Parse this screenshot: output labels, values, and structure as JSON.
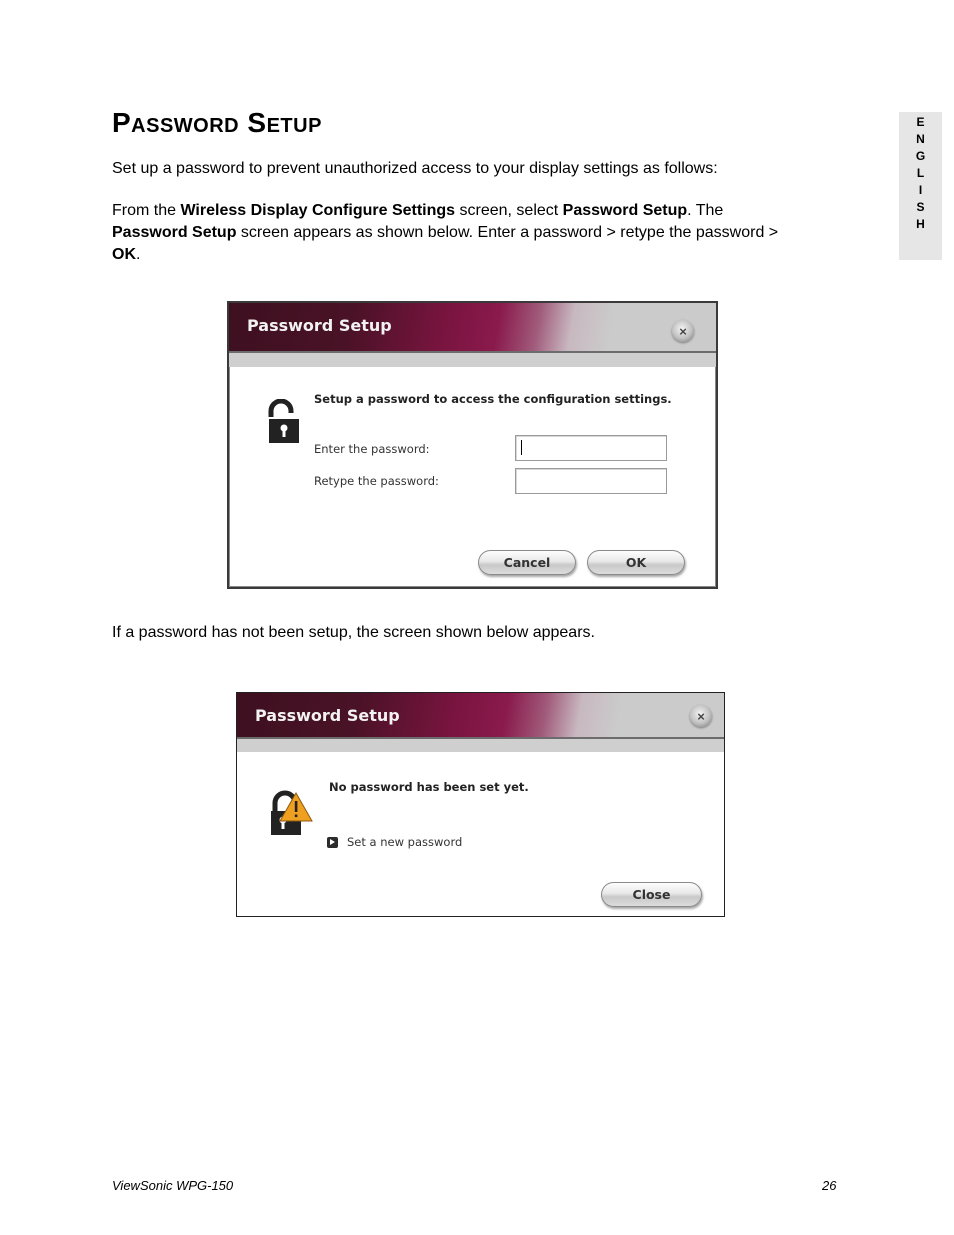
{
  "page": {
    "title": "Password Setup",
    "side_tab": [
      "E",
      "N",
      "G",
      "L",
      "I",
      "S",
      "H"
    ],
    "intro": "Set up a password to prevent unauthorized access to your display settings as follows:",
    "instructions": {
      "p1": "From the ",
      "b1": "Wireless Display Configure Settings",
      "p2": " screen, select ",
      "b2": "Password Setup",
      "p3": ". The ",
      "b3": "Password Setup",
      "p4": " screen appears as shown below. Enter a password > retype the password > ",
      "b4": "OK",
      "p5": "."
    },
    "note": "If a password has not been setup, the screen shown below appears."
  },
  "dialog_setup": {
    "title": "Password Setup",
    "close_icon": "close-x-circle",
    "lock_icon": "unlocked-padlock",
    "heading": "Setup a password to access the configuration settings.",
    "enter_label": "Enter the password:",
    "enter_value": "",
    "retype_label": "Retype the password:",
    "retype_value": "",
    "cancel_label": "Cancel",
    "ok_label": "OK"
  },
  "dialog_notset": {
    "title": "Password Setup",
    "close_icon": "close-x-circle",
    "lock_icon": "padlock-warning",
    "heading": "No password has been set yet.",
    "link_icon": "arrow-right-square",
    "link_label": "Set a new password",
    "close_label": "Close"
  },
  "footer": {
    "product": "ViewSonic WPG-150",
    "page_number": "26"
  }
}
